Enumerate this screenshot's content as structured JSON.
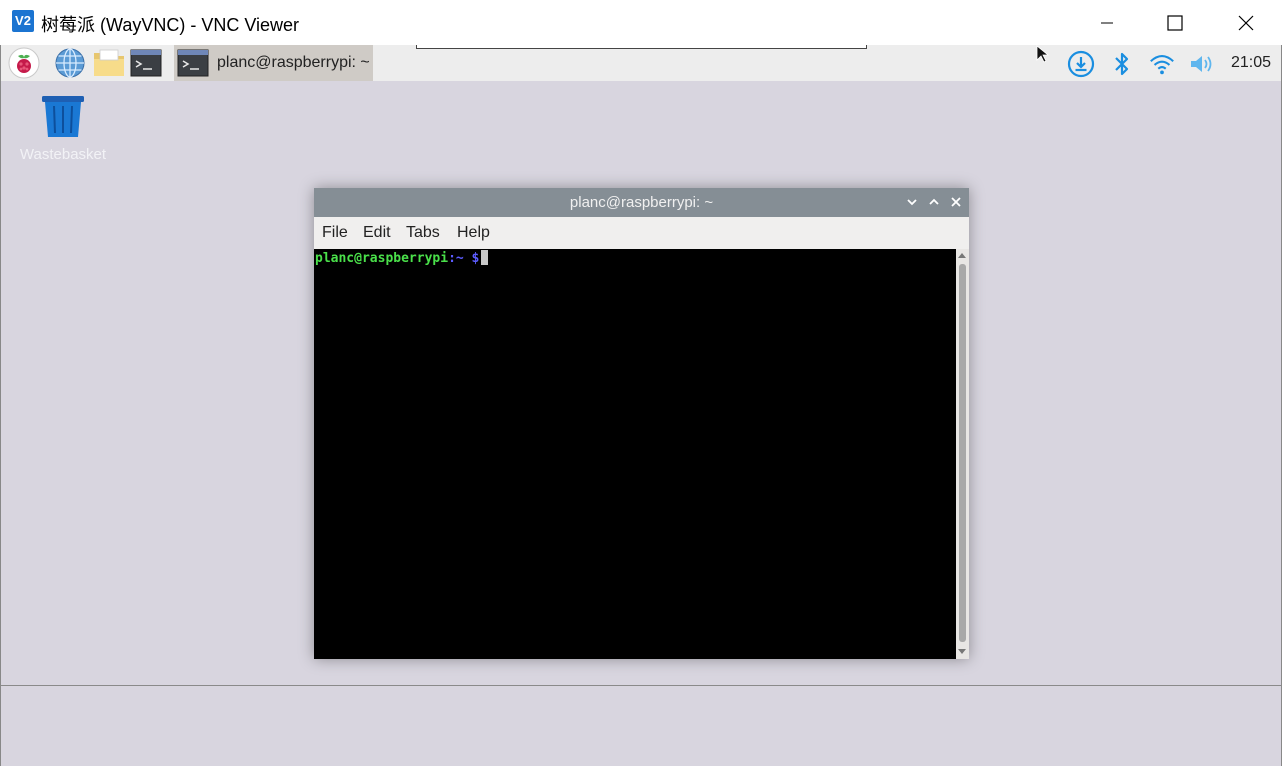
{
  "window": {
    "logo_text": "V2",
    "title": "树莓派 (WayVNC) - VNC Viewer"
  },
  "taskbar": {
    "launchers": [
      "raspberry-menu-icon",
      "web-browser-icon",
      "file-manager-icon",
      "terminal-icon"
    ],
    "active_task_label": "planc@raspberrypi: ~",
    "tray": [
      "download-icon",
      "bluetooth-icon",
      "wifi-icon",
      "volume-icon"
    ],
    "clock": "21:05"
  },
  "desktop": {
    "wastebasket_label": "Wastebasket"
  },
  "terminal": {
    "title": "planc@raspberrypi: ~",
    "menu": [
      "File",
      "Edit",
      "Tabs",
      "Help"
    ],
    "prompt_user": "planc@raspberrypi",
    "prompt_path": ":~ $"
  },
  "colors": {
    "desktop_bg": "#d8d5df",
    "terminal_titlebar": "#858e95",
    "prompt_user": "#4ae04a",
    "prompt_path": "#5c5cff",
    "tray_blue": "#1a8ee0"
  }
}
